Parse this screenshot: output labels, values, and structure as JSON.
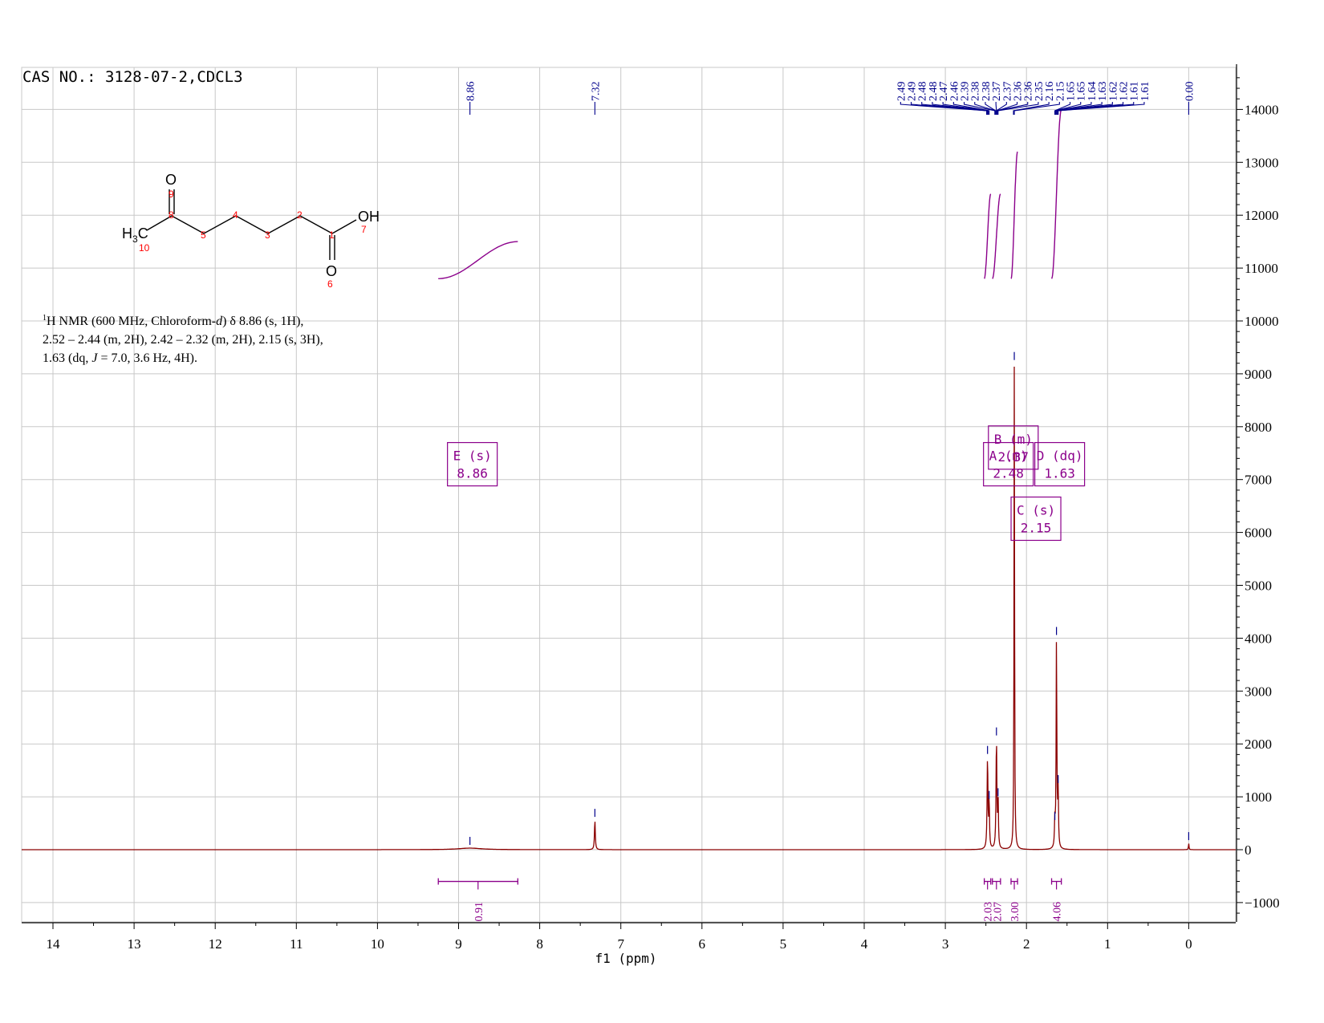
{
  "header": {
    "cas_title": "CAS NO.: 3128-07-2,CDCL3"
  },
  "description": {
    "sup": "1",
    "line1_a": "H NMR (600 MHz, Chloroform-",
    "line1_b": "d",
    "line1_c": ") δ 8.86 (s, 1H),",
    "line2": "2.52 – 2.44 (m, 2H), 2.42 – 2.32 (m, 2H), 2.15 (s, 3H),",
    "line3_a": "1.63 (dq, ",
    "line3_b": "J",
    "line3_c": " = 7.0, 3.6 Hz, 4H)."
  },
  "molecule": {
    "atoms": {
      "o_top": "O",
      "oh": "OH",
      "o_bottom": "O",
      "h3c_h": "H",
      "h3c_3": "3",
      "h3c_c": "C"
    },
    "numbers": [
      "1",
      "2",
      "3",
      "4",
      "5",
      "6",
      "7",
      "8",
      "9",
      "10"
    ]
  },
  "chart_data": {
    "type": "line",
    "xlabel": "f1 (ppm)",
    "ylabel": "",
    "xlim": [
      14.4,
      -0.45
    ],
    "ylim": [
      -1380,
      14700
    ],
    "x_ticks": [
      "14",
      "13",
      "12",
      "11",
      "10",
      "9",
      "8",
      "7",
      "6",
      "5",
      "4",
      "3",
      "2",
      "1",
      "0"
    ],
    "y_ticks": [
      "14000",
      "13000",
      "12000",
      "11000",
      "10000",
      "9000",
      "8000",
      "7000",
      "6000",
      "5000",
      "4000",
      "3000",
      "2000",
      "1000",
      "0",
      "−1000"
    ],
    "grid": true,
    "spectrum_peaks": [
      {
        "ppm": 8.86,
        "height": 30,
        "width": 0.35
      },
      {
        "ppm": 7.32,
        "height": 560,
        "width": 0.012
      },
      {
        "ppm": 2.48,
        "height": 1750,
        "width": 0.012
      },
      {
        "ppm": 2.46,
        "height": 900,
        "width": 0.01
      },
      {
        "ppm": 2.37,
        "height": 2100,
        "width": 0.012
      },
      {
        "ppm": 2.35,
        "height": 950,
        "width": 0.01
      },
      {
        "ppm": 2.15,
        "height": 9200,
        "width": 0.008
      },
      {
        "ppm": 1.65,
        "height": 500,
        "width": 0.01
      },
      {
        "ppm": 1.63,
        "height": 4000,
        "width": 0.01
      },
      {
        "ppm": 1.61,
        "height": 1200,
        "width": 0.01
      },
      {
        "ppm": 0.0,
        "height": 120,
        "width": 0.008
      }
    ],
    "peak_labels": [
      "8.86",
      "7.32",
      "2.49",
      "2.49",
      "2.48",
      "2.48",
      "2.47",
      "2.46",
      "2.39",
      "2.38",
      "2.38",
      "2.37",
      "2.37",
      "2.36",
      "2.36",
      "2.35",
      "2.16",
      "2.15",
      "1.65",
      "1.65",
      "1.64",
      "1.63",
      "1.62",
      "1.62",
      "1.61",
      "1.61",
      "0.00"
    ],
    "multiplets": [
      {
        "label": "E (s)",
        "shift": "8.86"
      },
      {
        "label": "B (m)",
        "shift": "2.37"
      },
      {
        "label": "A (m)",
        "shift": "2.48"
      },
      {
        "label": "D (dq)",
        "shift": "1.63"
      },
      {
        "label": "C (s)",
        "shift": "2.15"
      }
    ],
    "integrals": [
      {
        "value": "0.91",
        "from": 9.25,
        "to": 8.27,
        "curve_y0": 10800,
        "curve_y1": 11500
      },
      {
        "value": "2.03",
        "from": 2.52,
        "to": 2.44,
        "curve_y0": 10800,
        "curve_y1": 12400
      },
      {
        "value": "2.07",
        "from": 2.42,
        "to": 2.32,
        "curve_y0": 10800,
        "curve_y1": 12400
      },
      {
        "value": "3.00",
        "from": 2.19,
        "to": 2.11,
        "curve_y0": 10800,
        "curve_y1": 13200
      },
      {
        "value": "4.06",
        "from": 1.69,
        "to": 1.57,
        "curve_y0": 10800,
        "curve_y1": 14000
      }
    ],
    "colors": {
      "spectrum": "#8b0000",
      "peak_label": "#00008b",
      "integral": "#8b008b",
      "grid": "#c8c8c8",
      "atom_number": "#ff0000"
    }
  }
}
